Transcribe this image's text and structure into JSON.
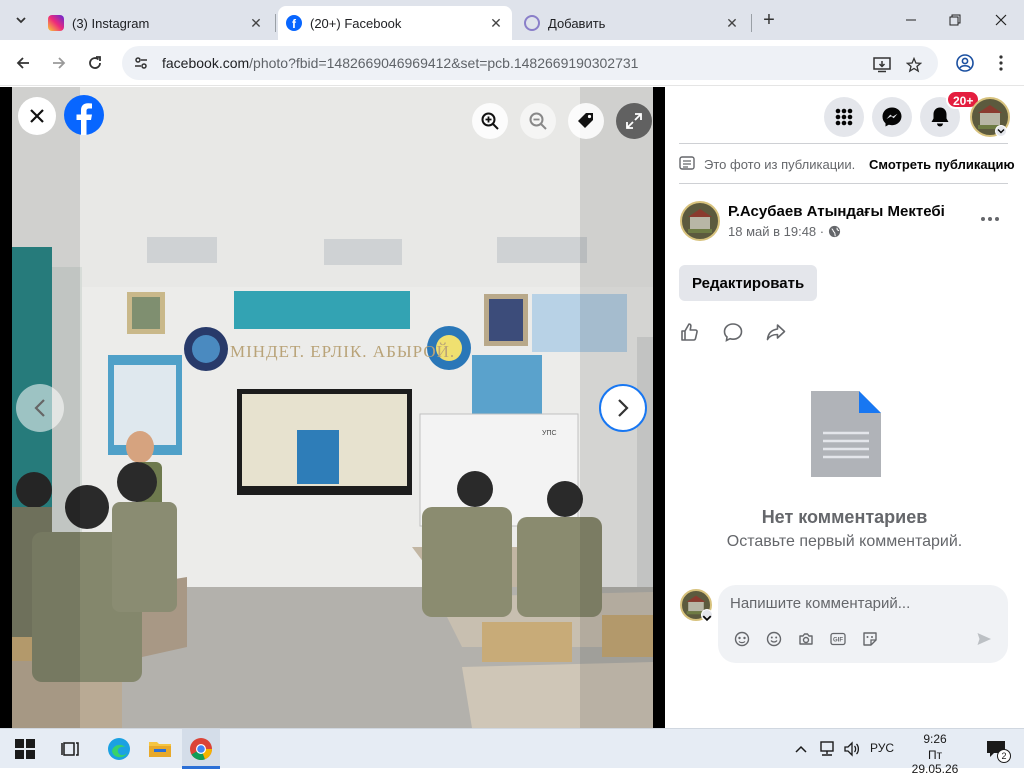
{
  "browser": {
    "tabs": [
      {
        "title": "(3) Instagram",
        "active": false
      },
      {
        "title": "(20+) Facebook",
        "active": true
      },
      {
        "title": "Добавить",
        "active": false
      }
    ],
    "url_host": "facebook.com",
    "url_rest": "/photo?fbid=1482669046969412&set=pcb.1482669190302731"
  },
  "header": {
    "notification_badge": "20+"
  },
  "post": {
    "from_publication_text": "Это фото из публикации.",
    "view_publication_link": "Смотреть публикацию",
    "author": "Р.Асубаев Атындағы Мектебі",
    "timestamp": "18 май в 19:48 ·",
    "edit_button": "Редактировать",
    "no_comments_title": "Нет комментариев",
    "no_comments_subtitle": "Оставьте первый комментарий.",
    "comment_placeholder": "Напишите комментарий..."
  },
  "photo": {
    "slogan": "МІНДЕТ. ЕРЛІК. АБЫРОЙ.",
    "board_label": "УПС"
  },
  "taskbar": {
    "lang": "РУС",
    "time": "9:26",
    "date": "Пт 29.05.26",
    "notif_count": "2"
  },
  "colors": {
    "facebook_blue": "#0866ff",
    "tabstrip": "#dfe3eb",
    "badge_red": "#e41e3f"
  }
}
